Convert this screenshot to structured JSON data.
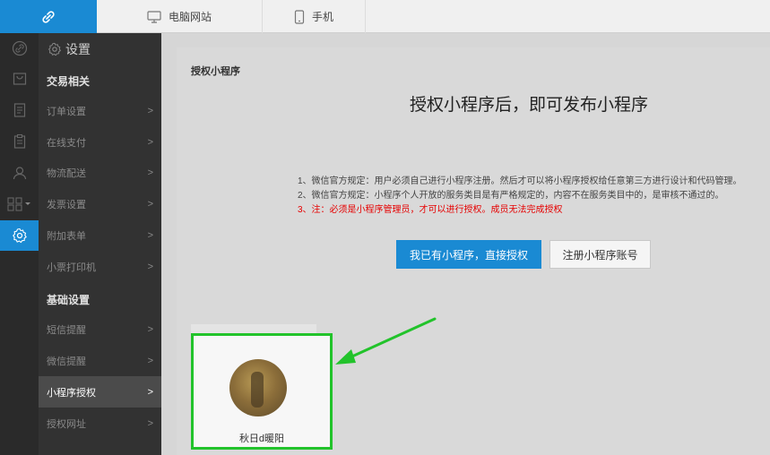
{
  "topbar": {
    "logo_icon": "link-icon",
    "tabs": [
      {
        "label": "电脑网站",
        "icon": "monitor-icon"
      },
      {
        "label": "手机",
        "icon": "phone-icon"
      }
    ]
  },
  "rail": {
    "items": [
      "link-icon",
      "bag-icon",
      "document-icon",
      "clipboard-icon",
      "user-icon",
      "grid-icon",
      "gear-icon"
    ],
    "active_index": 6
  },
  "sidebar": {
    "title": "设置",
    "group1": "交易相关",
    "items1": [
      {
        "label": "订单设置",
        "chev": ">"
      },
      {
        "label": "在线支付",
        "chev": ">"
      },
      {
        "label": "物流配送",
        "chev": ">"
      },
      {
        "label": "发票设置",
        "chev": ">"
      },
      {
        "label": "附加表单",
        "chev": ">"
      },
      {
        "label": "小票打印机",
        "chev": ">"
      }
    ],
    "group2": "基础设置",
    "items2": [
      {
        "label": "短信提醒",
        "chev": ">"
      },
      {
        "label": "微信提醒",
        "chev": ">"
      },
      {
        "label": "小程序授权",
        "chev": ">"
      },
      {
        "label": "授权网址",
        "chev": ">"
      }
    ]
  },
  "main": {
    "panel_title": "授权小程序",
    "headline": "授权小程序后，即可发布小程序",
    "rules": [
      "1、微信官方规定：用户必须自己进行小程序注册。然后才可以将小程序授权给任意第三方进行设计和代码管理。",
      "2、微信官方规定：小程序个人开放的服务类目是有严格规定的，内容不在服务类目中的，是审核不通过的。",
      "3、注：必须是小程序管理员，才可以进行授权。成员无法完成授权"
    ],
    "btn_primary": "我已有小程序，直接授权",
    "btn_secondary": "注册小程序账号",
    "account_name": "秋日d暖阳"
  },
  "colors": {
    "accent": "#1a8ad3",
    "warn": "#e60000",
    "highlight": "#22c32b"
  }
}
